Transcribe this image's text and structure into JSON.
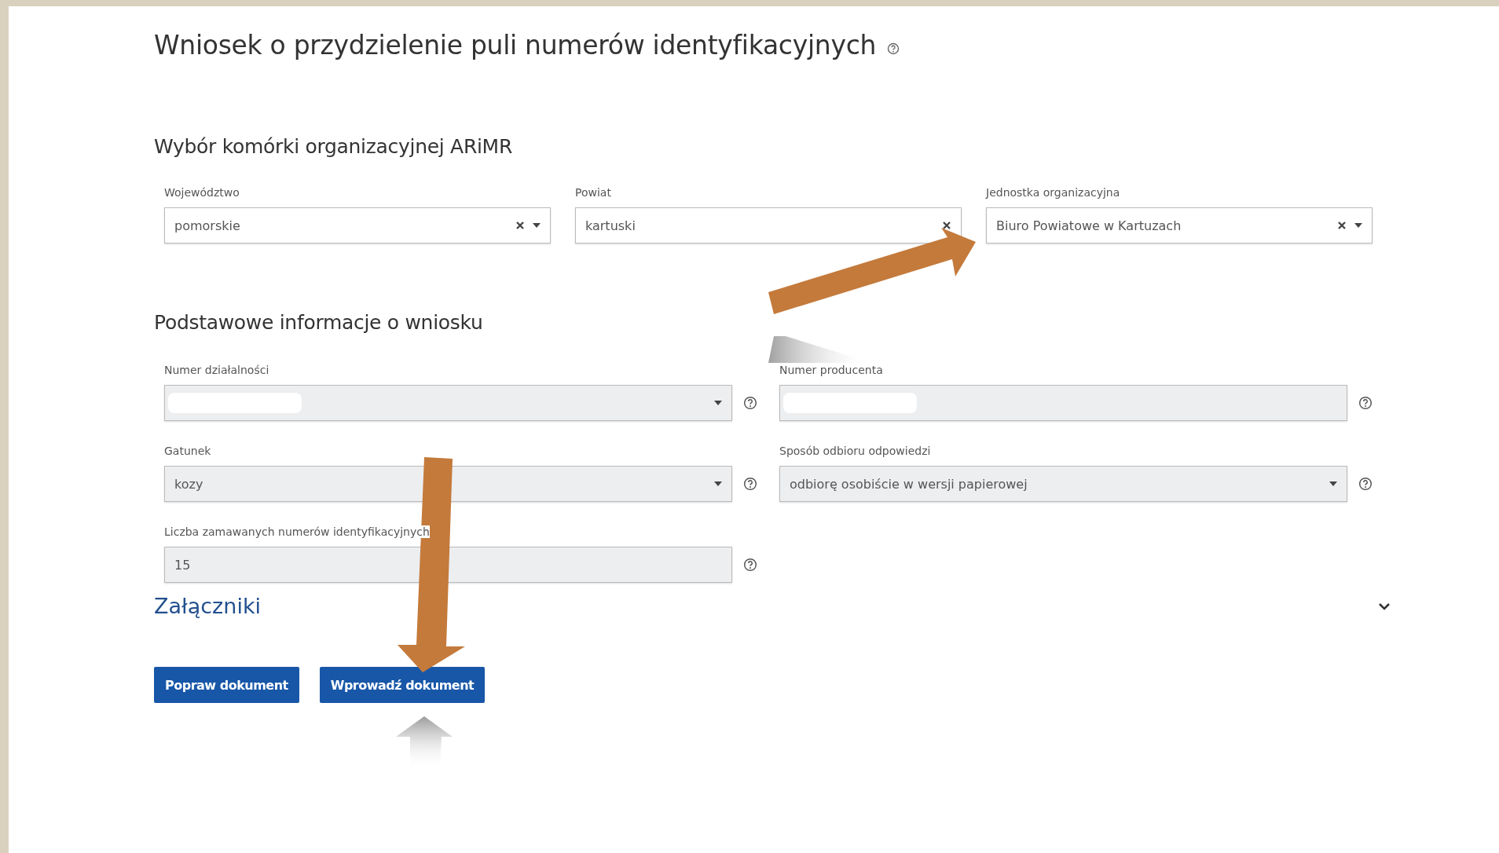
{
  "title": "Wniosek o przydzielenie puli numerów identyfikacyjnych",
  "sections": [
    {
      "heading": "Wybór komórki organizacyjnej ARiMR",
      "fields": [
        {
          "label": "Województwo",
          "value": "pomorskie",
          "clearable": true,
          "dropdown": true,
          "help": false,
          "disabled": false,
          "redacted": false
        },
        {
          "label": "Powiat",
          "value": "kartuski",
          "clearable": true,
          "dropdown": false,
          "help": false,
          "disabled": false,
          "redacted": false
        },
        {
          "label": "Jednostka organizacyjna",
          "value": "Biuro Powiatowe w Kartuzach",
          "clearable": true,
          "dropdown": true,
          "help": false,
          "disabled": false,
          "redacted": false
        }
      ]
    },
    {
      "heading": "Podstawowe informacje o wniosku",
      "fields": [
        {
          "label": "Numer działalności",
          "clearable": false,
          "dropdown": true,
          "help": true,
          "disabled": true,
          "redacted": true
        },
        {
          "label": "Numer producenta",
          "clearable": false,
          "dropdown": false,
          "help": true,
          "disabled": true,
          "redacted": true
        },
        {
          "label": "Gatunek",
          "value": "kozy",
          "clearable": false,
          "dropdown": true,
          "help": true,
          "disabled": true,
          "redacted": false
        },
        {
          "label": "Sposób odbioru odpowiedzi",
          "value": "odbiorę osobiście w wersji papierowej",
          "clearable": false,
          "dropdown": true,
          "help": true,
          "disabled": true,
          "redacted": false
        },
        {
          "label": "Liczba zamawanych numerów identyfikacyjnych",
          "value": "15",
          "clearable": false,
          "dropdown": false,
          "help": true,
          "disabled": true,
          "redacted": false
        }
      ]
    }
  ],
  "attachments": {
    "heading": "Załączniki",
    "expanded": false
  },
  "buttons": [
    "Popraw dokument",
    "Wprowadź dokument"
  ]
}
